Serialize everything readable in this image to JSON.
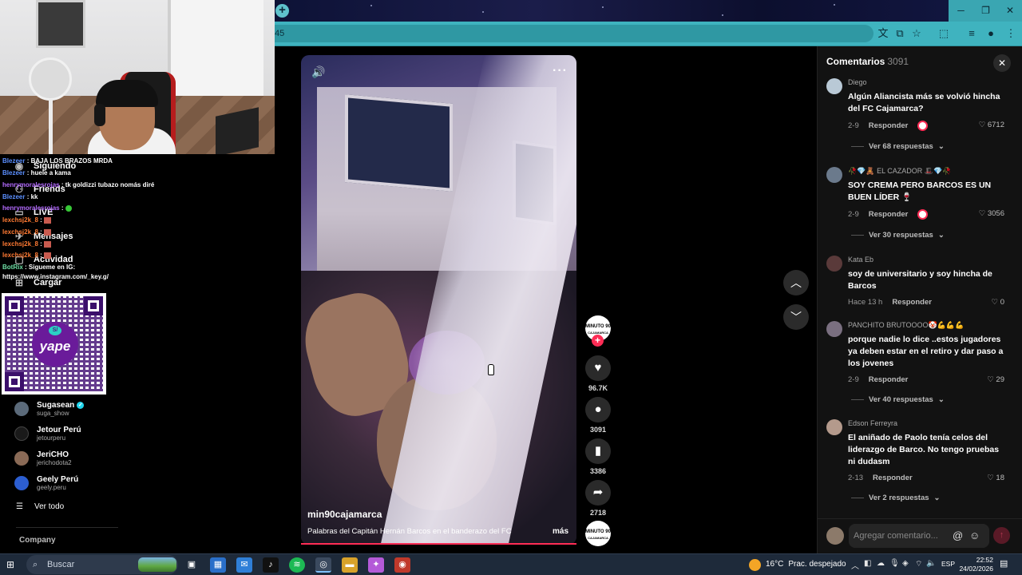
{
  "browser": {
    "new_tab": "+",
    "window_controls": {
      "minimize": "─",
      "maximize": "❐",
      "close": "✕"
    },
    "url_fragment": "45",
    "toolbar_icons": [
      "translate-icon",
      "cast-icon",
      "star-icon",
      "extensions-icon",
      "media-icon",
      "profile-icon",
      "menu-icon"
    ]
  },
  "chat_overlay": [
    {
      "user": "Blezeer",
      "message": ": BAJA LOS BRAZOS MRDA"
    },
    {
      "user": "Blezeer",
      "message": ": huele a kama"
    },
    {
      "user": "henrymoralesrojas",
      "message": ": tk goldizzi tubazo nomás diré"
    },
    {
      "user": "Blezeer",
      "message": ": kk"
    },
    {
      "user": "henrymoralesrojas",
      "message": ":"
    },
    {
      "user": "lexchsj2k_8",
      "message": ":"
    },
    {
      "user": "lexchsj2k_8",
      "message": ":"
    },
    {
      "user": "lexchsj2k_8",
      "message": ":"
    },
    {
      "user": "lexchsj2k_8",
      "message": ":"
    },
    {
      "user": "BotRix",
      "message": ": Sigueme en IG:"
    },
    {
      "user": "",
      "message": "https://www.instagram.com/_key.g/"
    }
  ],
  "sidebar": {
    "nav": [
      {
        "label": "Siguiendo",
        "icon": "following-icon"
      },
      {
        "label": "Friends",
        "icon": "friends-icon"
      },
      {
        "label": "LIVE",
        "icon": "live-icon"
      },
      {
        "label": "Mensajes",
        "icon": "messages-icon"
      },
      {
        "label": "Actividad",
        "icon": "activity-icon"
      },
      {
        "label": "Cargar",
        "icon": "upload-icon"
      }
    ],
    "qr_brand": "yape",
    "qr_badge": "S/",
    "accounts": [
      {
        "name": "Sugasean",
        "handle": "suga_show",
        "verified": true
      },
      {
        "name": "Jetour Perú",
        "handle": "jetourperu",
        "verified": false
      },
      {
        "name": "JeriCHO",
        "handle": "jerichodota2",
        "verified": false
      },
      {
        "name": "Geely Perú",
        "handle": "geely.peru",
        "verified": false
      }
    ],
    "see_all": "Ver todo",
    "company": "Company"
  },
  "video": {
    "author": "min90cajamarca",
    "description": "Palabras del Capitán Hernán Barcos en el banderazo del FC",
    "more": "más",
    "progress": 1.0,
    "creator_avatar_text": "MINUTO 90",
    "creator_avatar_sub": "CAJAMARCA",
    "likes": "96.7K",
    "comments": "3091",
    "saves": "3386",
    "shares": "2718"
  },
  "comments_panel": {
    "title": "Comentarios",
    "count": "3091",
    "reply_label": "Responder",
    "items": [
      {
        "user": "Diego",
        "text": "Algún Aliancista más se volvió hincha del FC Cajamarca?",
        "date": "2-9",
        "likes": "6712",
        "creator_liked": true,
        "replies": "Ver 68 respuestas"
      },
      {
        "user": "🥀💎🧸 EL CAZADOR 🎩💎🥀",
        "text": "SOY CREMA PERO BARCOS ES UN BUEN LÍDER 🍷",
        "date": "2-9",
        "likes": "3056",
        "creator_liked": true,
        "replies": "Ver 30 respuestas"
      },
      {
        "user": "Kata Eb",
        "text": "soy de universitario y soy hincha de Barcos",
        "date": "Hace 13 h",
        "likes": "0",
        "creator_liked": false,
        "replies": ""
      },
      {
        "user": "PANCHITO BRUTOOOO🤡💪💪💪",
        "text": "porque nadie lo dice ..estos jugadores ya deben estar en el retiro y dar paso a los jovenes",
        "date": "2-9",
        "likes": "29",
        "creator_liked": false,
        "replies": "Ver 40 respuestas"
      },
      {
        "user": "Edson Ferreyra",
        "text": "El aniñado de Paolo tenía celos del liderazgo de Barco. No tengo pruebas ni dudasm",
        "date": "2-13",
        "likes": "18",
        "creator_liked": false,
        "replies": "Ver 2 respuestas"
      }
    ],
    "input_placeholder": "Agregar comentario..."
  },
  "taskbar": {
    "search_placeholder": "Buscar",
    "weather_temp": "16°C",
    "weather_text": "Prac. despejado",
    "language": "ESP",
    "time": "22:52",
    "date": "24/02/2026"
  },
  "colors": {
    "accent": "#fe2c55",
    "browser_chrome": "#3fb3bf",
    "panel_bg": "#121212"
  }
}
